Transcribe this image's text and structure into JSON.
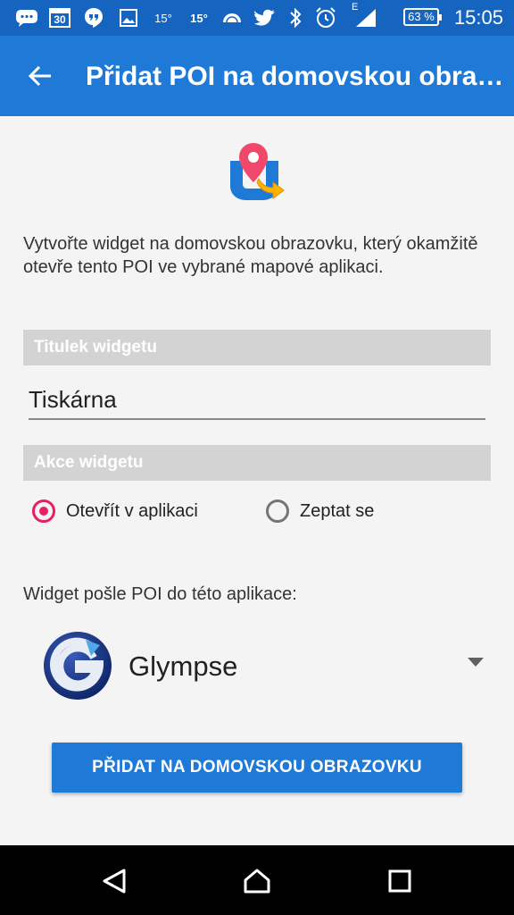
{
  "status_bar": {
    "temp1": "15°",
    "temp2": "15°",
    "calendar_day": "30",
    "network": "E",
    "battery": "63 %",
    "time": "15:05",
    "icons": [
      "message-icon",
      "calendar-icon",
      "hangouts-icon",
      "gallery-icon",
      "weather-icon",
      "weather-icon",
      "cloud-icon",
      "twitter-icon",
      "bluetooth-icon",
      "alarm-icon",
      "signal-icon",
      "battery-icon"
    ]
  },
  "app_bar": {
    "title": "Přidat POI na domovskou obrazovku",
    "back_icon": "arrow-left-icon"
  },
  "description": "Vytvořte widget na domovskou obrazovku, který okamžitě otevře tento POI ve vybrané mapové aplikaci.",
  "widget_title": {
    "header": "Titulek widgetu",
    "value": "Tiskárna"
  },
  "widget_action": {
    "header": "Akce widgetu",
    "options": [
      {
        "label": "Otevřít v aplikaci",
        "selected": true
      },
      {
        "label": "Zeptat se",
        "selected": false
      }
    ]
  },
  "target_app": {
    "label": "Widget pošle POI do této aplikace:",
    "selected_app": "Glympse"
  },
  "add_button": "PŘIDAT NA DOMOVSKOU OBRAZOVKU",
  "colors": {
    "status_bar": "#1565c0",
    "app_bar": "#1e7ad6",
    "accent": "#e91e63",
    "section_header": "#d3d3d3"
  },
  "nav_bar": [
    "back-icon",
    "home-icon",
    "recents-icon"
  ]
}
